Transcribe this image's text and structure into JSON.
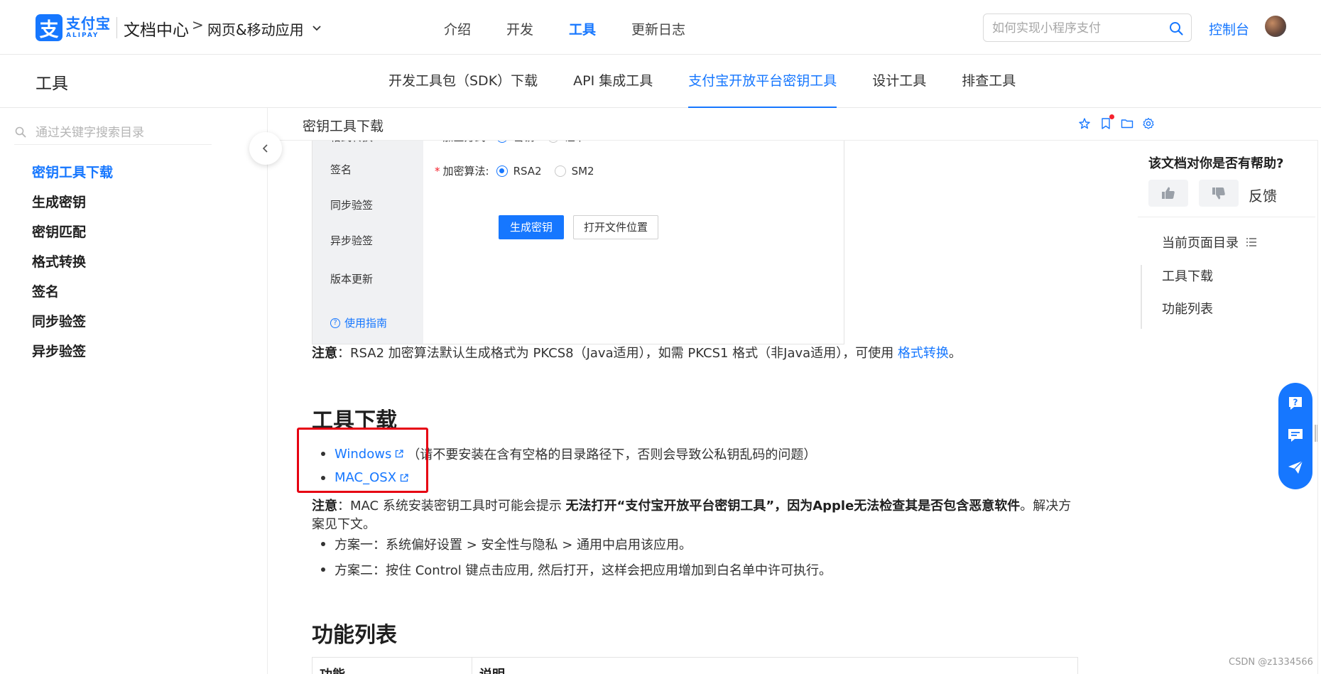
{
  "header": {
    "logo_cn": "支付宝",
    "logo_en": "ALIPAY",
    "logo_mark": "支",
    "doc_center": "文档中心",
    "breadcrumb_sep": ">",
    "breadcrumb_current": "网页&移动应用",
    "nav": [
      {
        "label": "介绍",
        "active": false
      },
      {
        "label": "开发",
        "active": false
      },
      {
        "label": "工具",
        "active": true
      },
      {
        "label": "更新日志",
        "active": false
      }
    ],
    "search_placeholder": "如何实现小程序支付",
    "console": "控制台"
  },
  "subheader": {
    "title": "工具",
    "tabs": [
      {
        "label": "开发工具包（SDK）下载",
        "active": false
      },
      {
        "label": "API 集成工具",
        "active": false
      },
      {
        "label": "支付宝开放平台密钥工具",
        "active": true
      },
      {
        "label": "设计工具",
        "active": false
      },
      {
        "label": "排查工具",
        "active": false
      }
    ]
  },
  "sidebar": {
    "search_placeholder": "通过关键字搜索目录",
    "items": [
      {
        "label": "密钥工具下载",
        "active": true
      },
      {
        "label": "生成密钥",
        "active": false
      },
      {
        "label": "密钥匹配",
        "active": false
      },
      {
        "label": "格式转换",
        "active": false
      },
      {
        "label": "签名",
        "active": false
      },
      {
        "label": "同步验签",
        "active": false
      },
      {
        "label": "异步验签",
        "active": false
      }
    ]
  },
  "content": {
    "head_title": "密钥工具下载",
    "tool_screenshot": {
      "side_items": [
        "格式转换",
        "签名",
        "同步验签",
        "异步验签",
        "版本更新"
      ],
      "guide": "使用指南",
      "row1_label": "加签方式:",
      "row1_options": [
        "密钥",
        "证书"
      ],
      "row2_label": "加密算法:",
      "row2_options": [
        "RSA2",
        "SM2"
      ],
      "btn_generate": "生成密钥",
      "btn_open": "打开文件位置"
    },
    "note1": {
      "label": "注意",
      "text": "：RSA2 加密算法默认生成格式为 PKCS8（Java适用），如需 PKCS1 格式（非Java适用），可使用 ",
      "link": "格式转换",
      "end": "。"
    },
    "download_heading": "工具下载",
    "downloads": [
      {
        "link": "Windows",
        "desc": "（请不要安装在含有空格的目录路径下，否则会导致公私钥乱码的问题）"
      },
      {
        "link": "MAC_OSX",
        "desc": ""
      }
    ],
    "note2": {
      "label": "注意",
      "text1": "：MAC 系统安装密钥工具时可能会提示 ",
      "bold": "无法打开“支付宝开放平台密钥工具”，因为Apple无法检查其是否包含恶意软件",
      "text2": "。解决方",
      "line2": "案见下文。"
    },
    "solutions": [
      "方案一：系统偏好设置 > 安全性与隐私 > 通用中启用该应用。",
      "方案二：按住 Control 键点击应用, 然后打开，这样会把应用增加到白名单中许可执行。"
    ],
    "function_heading": "功能列表",
    "table_headers": [
      "功能",
      "说明"
    ]
  },
  "right_panel": {
    "helpful_question": "该文档对你是否有帮助?",
    "feedback": "反馈",
    "toc_title": "当前页面目录",
    "toc_items": [
      "工具下载",
      "功能列表"
    ]
  },
  "watermark": "CSDN @z1334566",
  "colors": {
    "accent": "#1677ff",
    "highlight_box": "#e60012"
  }
}
